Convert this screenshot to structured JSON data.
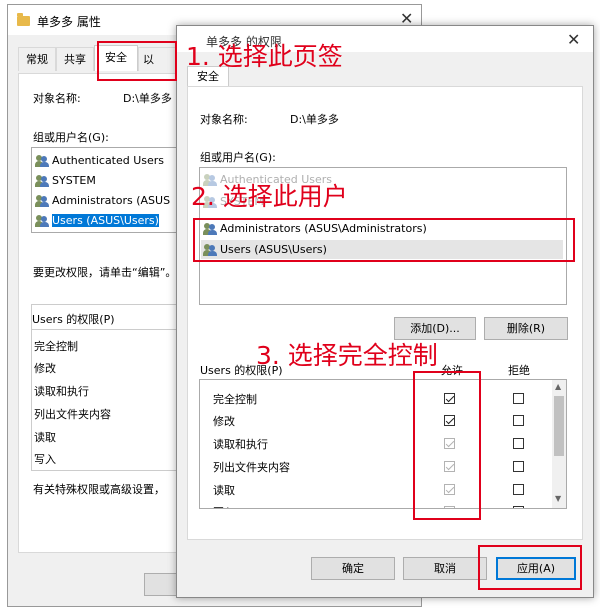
{
  "back_window": {
    "title": "单多多 属性",
    "tabs": [
      {
        "label": "常规"
      },
      {
        "label": "共享"
      },
      {
        "label": "安全"
      },
      {
        "label": "以"
      }
    ],
    "object_name_label": "对象名称:",
    "object_name_value": "D:\\单多多",
    "group_label": "组或用户名(G):",
    "users": [
      {
        "label": "Authenticated Users"
      },
      {
        "label": "SYSTEM"
      },
      {
        "label": "Administrators (ASUS"
      },
      {
        "label": "Users (ASUS\\Users)"
      }
    ],
    "change_perm_text": "要更改权限，请单击“编辑”。",
    "perm_label": "Users 的权限(P)",
    "permissions": [
      {
        "label": "完全控制"
      },
      {
        "label": "修改"
      },
      {
        "label": "读取和执行"
      },
      {
        "label": "列出文件夹内容"
      },
      {
        "label": "读取"
      },
      {
        "label": "写入"
      }
    ],
    "special_text": "有关特殊权限或高级设置，"
  },
  "front_window": {
    "title": "单多多 的权限",
    "tab_label": "安全",
    "object_name_label": "对象名称:",
    "object_name_value": "D:\\单多多",
    "group_label": "组或用户名(G):",
    "users": [
      {
        "label": "Authenticated Users"
      },
      {
        "label": "SYSTEM"
      },
      {
        "label": "Administrators (ASUS\\Administrators)"
      },
      {
        "label": "Users (ASUS\\Users)"
      }
    ],
    "add_button": "添加(D)...",
    "remove_button": "删除(R)",
    "perm_label": "Users 的权限(P)",
    "allow_header": "允许",
    "deny_header": "拒绝",
    "permissions": [
      {
        "label": "完全控制",
        "allow": true,
        "deny": false
      },
      {
        "label": "修改",
        "allow": true,
        "deny": false
      },
      {
        "label": "读取和执行",
        "allow": true,
        "deny": false
      },
      {
        "label": "列出文件夹内容",
        "allow": true,
        "deny": false
      },
      {
        "label": "读取",
        "allow": true,
        "deny": false
      },
      {
        "label": "写入",
        "allow": true,
        "deny": false
      }
    ],
    "ok_button": "确定",
    "cancel_button": "取消",
    "apply_button": "应用(A)"
  },
  "annotations": {
    "step1": "1. 选择此页签",
    "step2": "2. 选择此用户",
    "step3": "3. 选择完全控制"
  },
  "colors": {
    "annotation_red": "#e0001b",
    "selection_blue": "#0078d7"
  }
}
